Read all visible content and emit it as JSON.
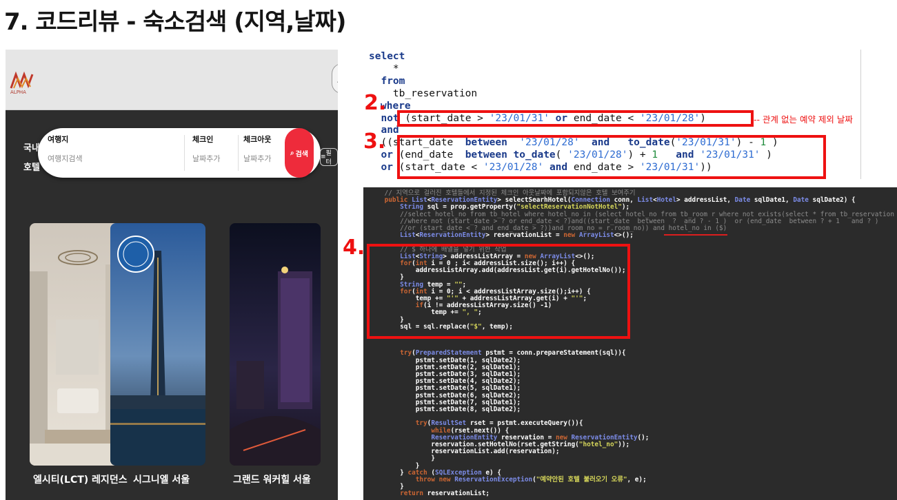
{
  "slide": {
    "title": "7. 코드리뷰 - 숙소검색 (지역,날짜)"
  },
  "app": {
    "logo_text": "ALPHA",
    "header_right_icon": "user-icon",
    "side_labels": [
      "국내",
      "호텔"
    ],
    "search": {
      "destination_label": "여행지",
      "destination_placeholder": "여행지검색",
      "checkin_label": "체크인",
      "checkin_value": "날짜추가",
      "checkout_label": "체크아웃",
      "checkout_value": "날짜추가",
      "button_label": "검색",
      "filter_label": "필터"
    },
    "hotels": [
      {
        "name": "엘시티(LCT) 레지던스"
      },
      {
        "name": "시그니엘 서울"
      },
      {
        "name": "그랜드 워커힐 서울"
      }
    ]
  },
  "sql": {
    "step2": "2.",
    "step3": "3.",
    "step4": "4.",
    "annotation": "-- 관계 없는 예약 제외 날짜",
    "lines": [
      "select",
      "    *",
      "  from",
      "    tb_reservation",
      "where",
      "  not (start_date > '23/01/31' or end_date < '23/01/28')",
      "  and",
      "  ((start_date  between  '23/01/28'  and   to_date('23/01/31') - 1 )",
      "  or (end_date  between to_date( '23/01/28') + 1   and '23/01/31' )",
      "  or (start_date < '23/01/28' and end_date > '23/01/31'))"
    ]
  },
  "editor": {
    "lines": [
      "    // 지역으로 걸러진 호텔들에서 지정된 체크인 아웃날짜에 포함되지않은 호텔 보여주기",
      "    public List<ReservationEntity> selectSearhHotel(Connection conn, List<Hotel> addressList, Date sqlDate1, Date sqlDate2) {",
      "        String sql = prop.getProperty(\"selectReservationNotHotel\");",
      "        //select hotel_no from tb_hotel where hotel_no in (select hotel_no from tb_room r where not exists(select * from tb_reservation",
      "        //where not (start_date > ? or end_date < ?)and((start_date  between  ?  and ? - 1 )  or (end_date  between ? + 1   and ? )",
      "        //or (start_date < ? and end_date > ?))and room_no = r.room_no)) and hotel_no in ($)",
      "        List<ReservationEntity> reservationList = new ArrayList<>();",
      "",
      "        // $ 하나에 배열을 넣기 위한 작업",
      "        List<String> addressListArray = new ArrayList<>();",
      "        for(int i = 0 ; i< addressList.size(); i++) {",
      "            addressListArray.add(addressList.get(i).getHotelNo());",
      "        }",
      "        String temp = \"\";",
      "        for(int i = 0; i < addressListArray.size();i++) {",
      "            temp += \"'\" + addressListArray.get(i) + \"'\";",
      "            if(i != addressListArray.size() -1)",
      "                temp += \", \";",
      "        }",
      "        sql = sql.replace(\"$\", temp);",
      "",
      "",
      "        try(PreparedStatement pstmt = conn.prepareStatement(sql)){",
      "            pstmt.setDate(1, sqlDate2);",
      "            pstmt.setDate(2, sqlDate1);",
      "            pstmt.setDate(3, sqlDate1);",
      "            pstmt.setDate(4, sqlDate2);",
      "            pstmt.setDate(5, sqlDate1);",
      "            pstmt.setDate(6, sqlDate2);",
      "            pstmt.setDate(7, sqlDate1);",
      "            pstmt.setDate(8, sqlDate2);",
      "",
      "            try(ResultSet rset = pstmt.executeQuery()){",
      "                while(rset.next()) {",
      "                ReservationEntity reservation = new ReservationEntity();",
      "                reservation.setHotelNo(rset.getString(\"hotel_no\"));",
      "                reservationList.add(reservation);",
      "                }",
      "            }",
      "        } catch (SQLException e) {",
      "            throw new ReservationException(\"예약안된 호텔 불러오기 오류\", e);",
      "        }",
      "        return reservationList;"
    ]
  },
  "colors": {
    "highlight_red": "#ee1111",
    "search_button": "#ee2b3b",
    "editor_bg": "#2b2b2b",
    "sql_keyword": "#1a3a8a",
    "sql_string": "#2d6bd1"
  }
}
